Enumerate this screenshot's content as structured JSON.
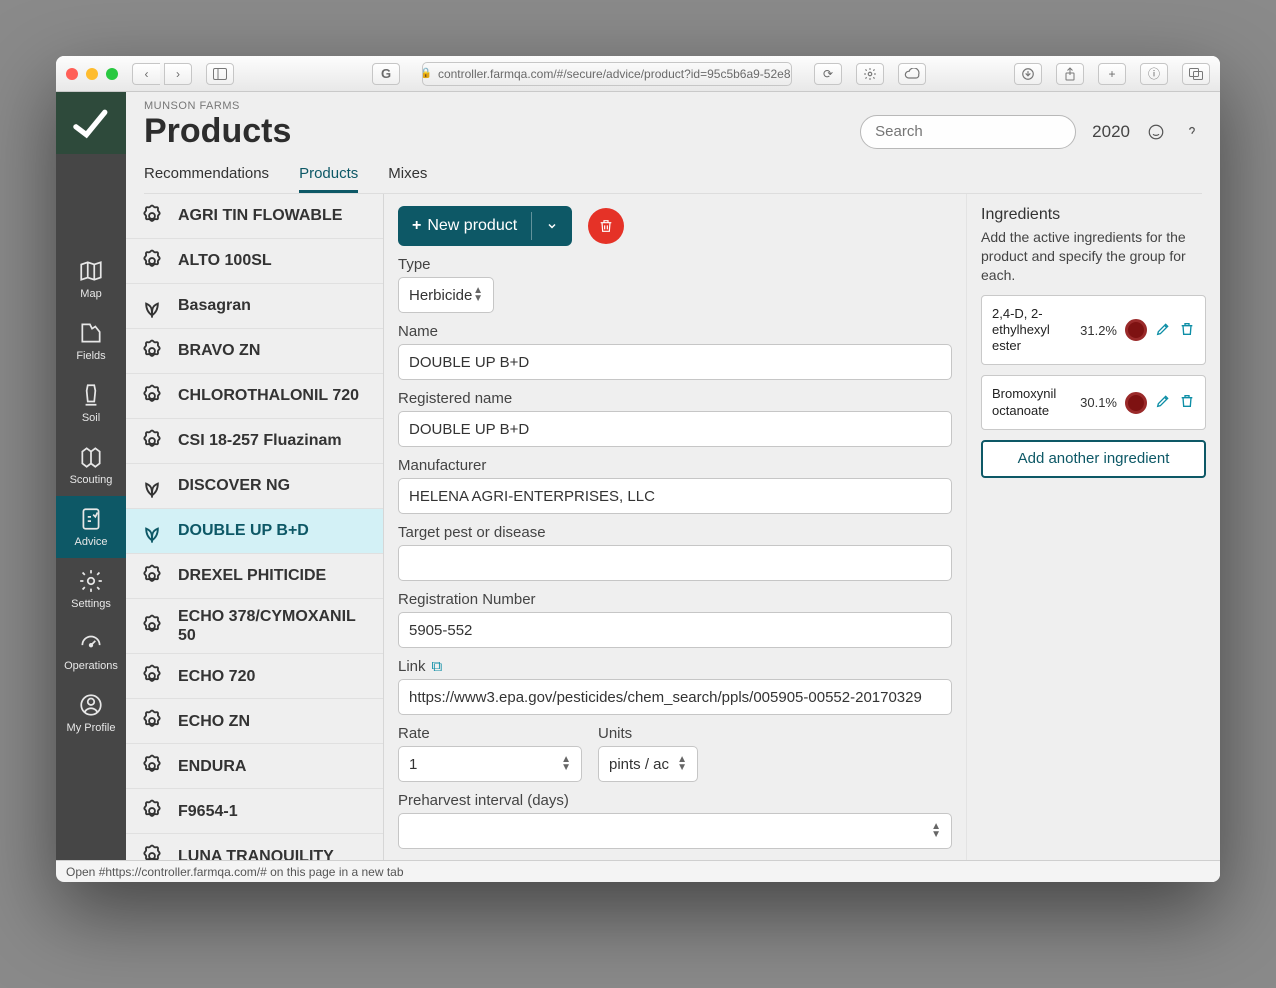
{
  "browser": {
    "url": "controller.farmqa.com/#/secure/advice/product?id=95c5b6a9-52e8-"
  },
  "header": {
    "farm": "MUNSON FARMS",
    "title": "Products",
    "search_placeholder": "Search",
    "year": "2020"
  },
  "tabs": [
    {
      "label": "Recommendations",
      "active": false
    },
    {
      "label": "Products",
      "active": true
    },
    {
      "label": "Mixes",
      "active": false
    }
  ],
  "sidebar": [
    {
      "id": "map",
      "label": "Map"
    },
    {
      "id": "fields",
      "label": "Fields"
    },
    {
      "id": "soil",
      "label": "Soil"
    },
    {
      "id": "scouting",
      "label": "Scouting"
    },
    {
      "id": "advice",
      "label": "Advice",
      "active": true
    },
    {
      "id": "settings",
      "label": "Settings"
    },
    {
      "id": "operations",
      "label": "Operations"
    },
    {
      "id": "myprofile",
      "label": "My Profile"
    }
  ],
  "products": [
    {
      "name": "AGRI TIN FLOWABLE",
      "icon": "gear"
    },
    {
      "name": "ALTO 100SL",
      "icon": "gear"
    },
    {
      "name": "Basagran",
      "icon": "sprout"
    },
    {
      "name": "BRAVO ZN",
      "icon": "gear"
    },
    {
      "name": "CHLOROTHALONIL 720",
      "icon": "gear"
    },
    {
      "name": "CSI 18-257 Fluazinam",
      "icon": "gear"
    },
    {
      "name": "DISCOVER NG",
      "icon": "sprout"
    },
    {
      "name": "DOUBLE UP B+D",
      "icon": "sprout",
      "selected": true
    },
    {
      "name": "DREXEL PHITICIDE",
      "icon": "gear"
    },
    {
      "name": "ECHO 378/CYMOXANIL 50",
      "icon": "gear"
    },
    {
      "name": "ECHO 720",
      "icon": "gear"
    },
    {
      "name": "ECHO ZN",
      "icon": "gear"
    },
    {
      "name": "ENDURA",
      "icon": "gear"
    },
    {
      "name": "F9654-1",
      "icon": "gear"
    },
    {
      "name": "LUNA TRANQUILITY",
      "icon": "gear"
    }
  ],
  "form": {
    "new_product_label": "New product",
    "type_label": "Type",
    "type_value": "Herbicide",
    "name_label": "Name",
    "name_value": "DOUBLE UP B+D",
    "regname_label": "Registered name",
    "regname_value": "DOUBLE UP B+D",
    "manufacturer_label": "Manufacturer",
    "manufacturer_value": "HELENA AGRI-ENTERPRISES, LLC",
    "target_label": "Target pest or disease",
    "target_value": "",
    "regnum_label": "Registration Number",
    "regnum_value": "5905-552",
    "link_label": "Link",
    "link_value": "https://www3.epa.gov/pesticides/chem_search/ppls/005905-00552-20170329",
    "rate_label": "Rate",
    "rate_value": "1",
    "units_label": "Units",
    "units_value": "pints / ac",
    "phi_label": "Preharvest interval (days)",
    "phi_value": ""
  },
  "ingredients_panel": {
    "title": "Ingredients",
    "hint": "Add the active ingredients for the product and specify the group for each.",
    "add_button": "Add another ingredient",
    "items": [
      {
        "name": "2,4-D, 2-ethylhexyl ester",
        "pct": "31.2%"
      },
      {
        "name": "Bromoxynil octanoate",
        "pct": "30.1%"
      }
    ]
  },
  "status_bar": "Open #https://controller.farmqa.com/# on this page in a new tab"
}
